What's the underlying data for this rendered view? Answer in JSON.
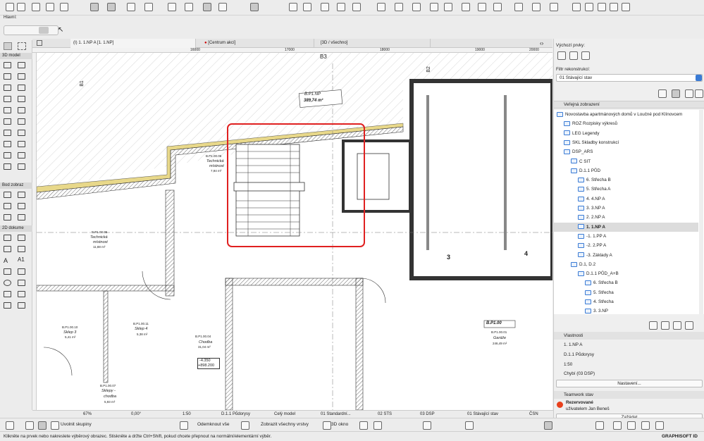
{
  "toolbar": {
    "label": "Hlavní:"
  },
  "palette": {
    "sections": [
      "3D model",
      "Bod zobraz",
      "2D dokume"
    ],
    "text_tool": "A1"
  },
  "tabs": [
    {
      "label": "(I) 1. 1.NP A [1. 1.NP]"
    },
    {
      "label": "[Centrum akcí]"
    },
    {
      "label": "[3D / všechno]"
    }
  ],
  "ruler": {
    "x16000": "16000",
    "x17000": "17000",
    "x18000": "18000",
    "x19000": "19000",
    "x20000": "20000"
  },
  "plan": {
    "axis_b3": "B3",
    "axis_b2": "B2",
    "axis_b1": "B1",
    "axis_3": "3",
    "axis_4": "4",
    "zone_bp1np": {
      "name": "B.P1.NP",
      "area": "389,74 m²"
    },
    "room_06": {
      "id": "B.P1.00.06",
      "name1": "Technická",
      "name2": "místnost",
      "area": "7,94 m²"
    },
    "room_05": {
      "id": "B.P1.00.05",
      "name1": "Technická",
      "name2": "místnost",
      "area": "11,88 m²"
    },
    "room_10": {
      "id": "B.P1.00.10",
      "name": "Sklep 3",
      "area": "5,41 m²"
    },
    "room_11": {
      "id": "B.P1.00.11",
      "name": "Sklep 4",
      "area": "5,38 m²"
    },
    "room_04": {
      "id": "B.P1.00.04",
      "name": "Chodba",
      "area": "31,04 m²"
    },
    "room_07": {
      "id": "B.P1.00.07",
      "name1": "Sklepy -",
      "name2": "chodba",
      "area": "5,93 m²"
    },
    "room_01": {
      "id": "B.P1.00.01",
      "name": "Garáže",
      "area": "246,49 m²"
    },
    "zone_bp100": {
      "name": "B.P1.00"
    },
    "level1": "-4.350",
    "level2": "+898.200"
  },
  "status_bar": {
    "zoom": "67%",
    "angle": "0,00°",
    "scale": "1:50",
    "view": "D.1.1 Půdorysy",
    "model": "Celý model",
    "pen": "01 Standardní...",
    "sts": "02 STS",
    "dsp": "03 DSP",
    "renov": "01 Stávající stav",
    "csn": "ČSN"
  },
  "right_panel": {
    "default_elements": "Výchozí prvky:",
    "renov_filter": "Filtr rekonstrukcí:",
    "renov_value": "01 Stávající stav",
    "public_views": "Veřejná zobrazení",
    "tree": [
      {
        "label": "Novostavba apartmánových domů v Loučné pod Klínovcem",
        "indent": 0
      },
      {
        "label": "ROZ Rozpisky výkresů",
        "indent": 1
      },
      {
        "label": "LEG Legendy",
        "indent": 1
      },
      {
        "label": "SKL Skladby konstrukcí",
        "indent": 1
      },
      {
        "label": "DSP_ARS",
        "indent": 1
      },
      {
        "label": "C SIT",
        "indent": 2
      },
      {
        "label": "D.1.1 PŮD",
        "indent": 2
      },
      {
        "label": "6. Střecha B",
        "indent": 3
      },
      {
        "label": "5. Střecha A",
        "indent": 3
      },
      {
        "label": "4. 4.NP A",
        "indent": 3
      },
      {
        "label": "3. 3.NP A",
        "indent": 3
      },
      {
        "label": "2. 2.NP A",
        "indent": 3
      },
      {
        "label": "1. 1.NP A",
        "indent": 3,
        "selected": true
      },
      {
        "label": "-1. 1.PP A",
        "indent": 3
      },
      {
        "label": "-2. 2.PP A",
        "indent": 3
      },
      {
        "label": "-3. Základy A",
        "indent": 3
      },
      {
        "label": "D.1, D.2",
        "indent": 2
      },
      {
        "label": "D.1.1 PŮD_A+B",
        "indent": 3
      },
      {
        "label": "6. Střecha B",
        "indent": 4
      },
      {
        "label": "5. Střecha",
        "indent": 4
      },
      {
        "label": "4. Střecha",
        "indent": 4
      },
      {
        "label": "3. 3.NP",
        "indent": 4
      }
    ],
    "properties_title": "Vlastnosti",
    "prop_name": "1. 1.NP A",
    "prop_view": "D.1.1 Půdorysy",
    "prop_scale": "1:50",
    "prop_missing": "Chybí (03 DSP)",
    "settings_button": "Nastavení...",
    "teamwork_title": "Teamwork stav",
    "tw_status": "Rezervované",
    "tw_user": "uživatelem Jan Beneš",
    "request_button": "Zažádat"
  },
  "bottom_toolbar": {
    "ungroup": "Uvolnit skupiny",
    "unlock": "Odemknout vše",
    "show_layers": "Zobrazit všechny vrstvy",
    "window_3d": "3D okno"
  },
  "footer": {
    "hint": "Klikněte na prvek nebo nakreslete výběrový obrazec. Stiskněte a držte Ctrl+Shift, pokud chcete přepnout na normální/elementární výběr.",
    "brand": "GRAPHISOFT ID"
  },
  "colors": {
    "highlight": "#e02020",
    "wall_hatch": "#444444",
    "insulation": "#e8d88a",
    "teamwork_dot": "#e8401c",
    "folder": "#3a7bd5"
  }
}
